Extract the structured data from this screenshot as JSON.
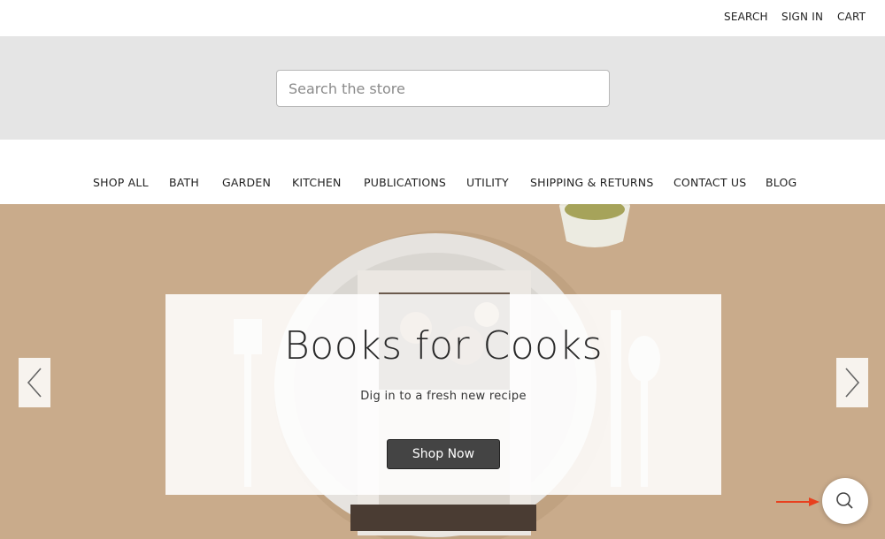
{
  "utility_nav": {
    "search": "SEARCH",
    "sign_in": "SIGN IN",
    "cart": "CART"
  },
  "search": {
    "placeholder": "Search the store"
  },
  "nav": {
    "items": [
      "SHOP ALL",
      "BATH",
      "GARDEN",
      "KITCHEN",
      "PUBLICATIONS",
      "UTILITY",
      "SHIPPING & RETURNS",
      "CONTACT US",
      "BLOG"
    ]
  },
  "hero": {
    "headline": "Books for Cooks",
    "subtext": "Dig in to a fresh new recipe",
    "button_label": "Shop Now"
  },
  "icons": {
    "prev": "chevron-left-icon",
    "next": "chevron-right-icon",
    "fab": "search-icon",
    "annotation": "red-arrow-icon"
  },
  "colors": {
    "hero_background": "#c9ab8b",
    "search_band": "#e5e5e5",
    "button": "#444444",
    "annotation_arrow": "#e8401e"
  }
}
